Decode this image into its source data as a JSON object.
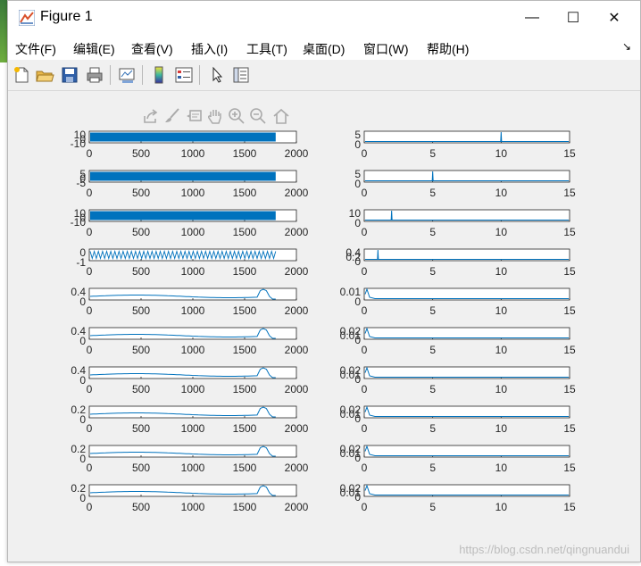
{
  "window": {
    "title": "Figure 1",
    "minimize": "—",
    "maximize": "☐",
    "close": "✕"
  },
  "menu": {
    "items": [
      "文件(F)",
      "编辑(E)",
      "查看(V)",
      "插入(I)",
      "工具(T)",
      "桌面(D)",
      "窗口(W)",
      "帮助(H)"
    ],
    "overflow": "↘"
  },
  "toolbar": {
    "buttons": [
      "new-figure-icon",
      "open-file-icon",
      "save-icon",
      "print-icon",
      "link-plot-icon",
      "insert-colorbar-icon",
      "insert-legend-icon",
      "edit-plot-pointer-icon",
      "property-inspector-icon"
    ]
  },
  "axes_toolbar": {
    "buttons": [
      "export-icon",
      "brush-icon",
      "datatip-icon",
      "pan-hand-icon",
      "zoom-in-icon",
      "zoom-out-icon",
      "home-icon"
    ]
  },
  "watermark": "https://blog.csdn.net/qingnuandui",
  "chart_data": [
    {
      "type": "line",
      "panel": "left-1",
      "xlim": [
        0,
        2000
      ],
      "yticks": [
        "10",
        "0",
        "-10"
      ],
      "xticks": [
        "0",
        "500",
        "1000",
        "1500",
        "2000"
      ],
      "x_end": 1800,
      "signal": "dense-oscillation"
    },
    {
      "type": "line",
      "panel": "left-2",
      "xlim": [
        0,
        2000
      ],
      "yticks": [
        "5",
        "0",
        "-5"
      ],
      "xticks": [
        "0",
        "500",
        "1000",
        "1500",
        "2000"
      ],
      "x_end": 1800,
      "signal": "dense-oscillation"
    },
    {
      "type": "line",
      "panel": "left-3",
      "xlim": [
        0,
        2000
      ],
      "yticks": [
        "10",
        "0",
        "-10"
      ],
      "xticks": [
        "0",
        "500",
        "1000",
        "1500",
        "2000"
      ],
      "x_end": 1800,
      "signal": "dense-oscillation"
    },
    {
      "type": "line",
      "panel": "left-4",
      "xlim": [
        0,
        2000
      ],
      "yticks": [
        "0",
        "-1"
      ],
      "xticks": [
        "0",
        "500",
        "1000",
        "1500",
        "2000"
      ],
      "x_end": 1800,
      "signal": "oscillation"
    },
    {
      "type": "line",
      "panel": "left-5",
      "xlim": [
        0,
        2000
      ],
      "yticks": [
        "0.4",
        "0"
      ],
      "xticks": [
        "0",
        "500",
        "1000",
        "1500",
        "2000"
      ],
      "x_end": 1800,
      "signal": "slow-with-end-spike"
    },
    {
      "type": "line",
      "panel": "left-6",
      "xlim": [
        0,
        2000
      ],
      "yticks": [
        "0.4",
        "0"
      ],
      "xticks": [
        "0",
        "500",
        "1000",
        "1500",
        "2000"
      ],
      "x_end": 1800,
      "signal": "slow-with-end-spike"
    },
    {
      "type": "line",
      "panel": "left-7",
      "xlim": [
        0,
        2000
      ],
      "yticks": [
        "0.4",
        "0"
      ],
      "xticks": [
        "0",
        "500",
        "1000",
        "1500",
        "2000"
      ],
      "x_end": 1800,
      "signal": "slow-with-end-spike"
    },
    {
      "type": "line",
      "panel": "left-8",
      "xlim": [
        0,
        2000
      ],
      "yticks": [
        "0.2",
        "0"
      ],
      "xticks": [
        "0",
        "500",
        "1000",
        "1500",
        "2000"
      ],
      "x_end": 1800,
      "signal": "slow-with-end-spike"
    },
    {
      "type": "line",
      "panel": "left-9",
      "xlim": [
        0,
        2000
      ],
      "yticks": [
        "0.2",
        "0"
      ],
      "xticks": [
        "0",
        "500",
        "1000",
        "1500",
        "2000"
      ],
      "x_end": 1800,
      "signal": "slow-with-end-spike"
    },
    {
      "type": "line",
      "panel": "left-10",
      "xlim": [
        0,
        2000
      ],
      "yticks": [
        "0.2",
        "0"
      ],
      "xticks": [
        "0",
        "500",
        "1000",
        "1500",
        "2000"
      ],
      "x_end": 1800,
      "signal": "slow-with-end-spike"
    },
    {
      "type": "line",
      "panel": "right-1",
      "xlim": [
        0,
        15
      ],
      "yticks": [
        "5",
        "0"
      ],
      "xticks": [
        "0",
        "5",
        "10",
        "15"
      ],
      "spike_x": 10,
      "signal": "single-spike"
    },
    {
      "type": "line",
      "panel": "right-2",
      "xlim": [
        0,
        15
      ],
      "yticks": [
        "5",
        "0"
      ],
      "xticks": [
        "0",
        "5",
        "10",
        "15"
      ],
      "spike_x": 5,
      "signal": "single-spike"
    },
    {
      "type": "line",
      "panel": "right-3",
      "xlim": [
        0,
        15
      ],
      "yticks": [
        "10",
        "0"
      ],
      "xticks": [
        "0",
        "5",
        "10",
        "15"
      ],
      "spike_x": 2,
      "signal": "single-spike"
    },
    {
      "type": "line",
      "panel": "right-4",
      "xlim": [
        0,
        15
      ],
      "yticks": [
        "0.4",
        "0.2",
        "0"
      ],
      "xticks": [
        "0",
        "5",
        "10",
        "15"
      ],
      "spike_x": 1,
      "signal": "single-spike"
    },
    {
      "type": "line",
      "panel": "right-5",
      "xlim": [
        0,
        15
      ],
      "yticks": [
        "0.01",
        "0"
      ],
      "xticks": [
        "0",
        "5",
        "10",
        "15"
      ],
      "signal": "decay"
    },
    {
      "type": "line",
      "panel": "right-6",
      "xlim": [
        0,
        15
      ],
      "yticks": [
        "0.02",
        "0.01",
        "0"
      ],
      "xticks": [
        "0",
        "5",
        "10",
        "15"
      ],
      "signal": "decay"
    },
    {
      "type": "line",
      "panel": "right-7",
      "xlim": [
        0,
        15
      ],
      "yticks": [
        "0.02",
        "0.01",
        "0"
      ],
      "xticks": [
        "0",
        "5",
        "10",
        "15"
      ],
      "signal": "decay"
    },
    {
      "type": "line",
      "panel": "right-8",
      "xlim": [
        0,
        15
      ],
      "yticks": [
        "0.02",
        "0.01",
        "0"
      ],
      "xticks": [
        "0",
        "5",
        "10",
        "15"
      ],
      "signal": "decay"
    },
    {
      "type": "line",
      "panel": "right-9",
      "xlim": [
        0,
        15
      ],
      "yticks": [
        "0.02",
        "0.01",
        "0"
      ],
      "xticks": [
        "0",
        "5",
        "10",
        "15"
      ],
      "signal": "decay"
    },
    {
      "type": "line",
      "panel": "right-10",
      "xlim": [
        0,
        15
      ],
      "yticks": [
        "0.02",
        "0.01",
        "0"
      ],
      "xticks": [
        "0",
        "5",
        "10",
        "15"
      ],
      "signal": "decay"
    }
  ]
}
